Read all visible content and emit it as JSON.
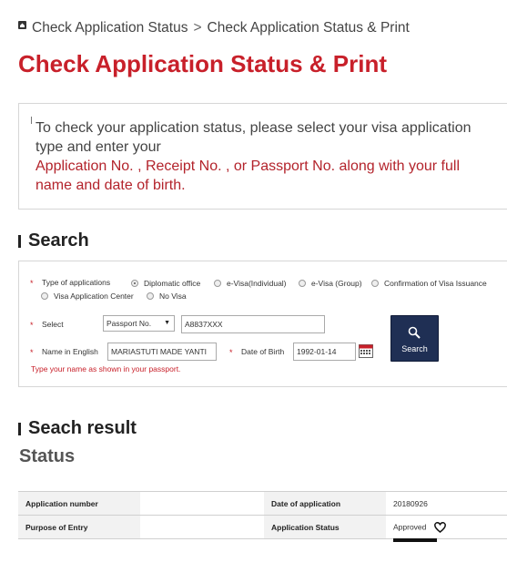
{
  "breadcrumb": {
    "items": [
      "Check Application Status",
      "Check Application Status & Print"
    ],
    "separator": ">"
  },
  "page_title": "Check Application Status & Print",
  "info": {
    "text": "To check your application status, please select your visa application type and enter your",
    "highlight": "Application No. , Receipt No. , or Passport No. along with your full name and date of birth."
  },
  "search_section": {
    "title": "Search",
    "type_label": "Type of applications",
    "types": [
      {
        "label": "Diplomatic office",
        "checked": true
      },
      {
        "label": "e-Visa(Individual)",
        "checked": false
      },
      {
        "label": "e-Visa (Group)",
        "checked": false
      },
      {
        "label": "Confirmation of Visa Issuance",
        "checked": false
      },
      {
        "label": "Visa Application Center",
        "checked": false
      },
      {
        "label": "No Visa",
        "checked": false
      }
    ],
    "select_label": "Select",
    "select_value": "Passport No.",
    "number_value": "A8837XXX",
    "name_label": "Name in English",
    "name_value": "MARIASTUTI MADE YANTI",
    "dob_label": "Date of Birth",
    "dob_value": "1992-01-14",
    "hint": "Type your name as shown in your passport.",
    "button_label": "Search"
  },
  "result_section": {
    "title": "Seach result",
    "status_title": "Status",
    "rows": [
      {
        "label1": "Application number",
        "value1": "",
        "label2": "Date of application",
        "value2": "20180926"
      },
      {
        "label1": "Purpose of Entry",
        "value1": "",
        "label2": "Application Status",
        "value2": "Approved"
      }
    ]
  },
  "colors": {
    "accent": "#c8202a",
    "button": "#1f2f54",
    "table_header": "#f2f2f2"
  }
}
